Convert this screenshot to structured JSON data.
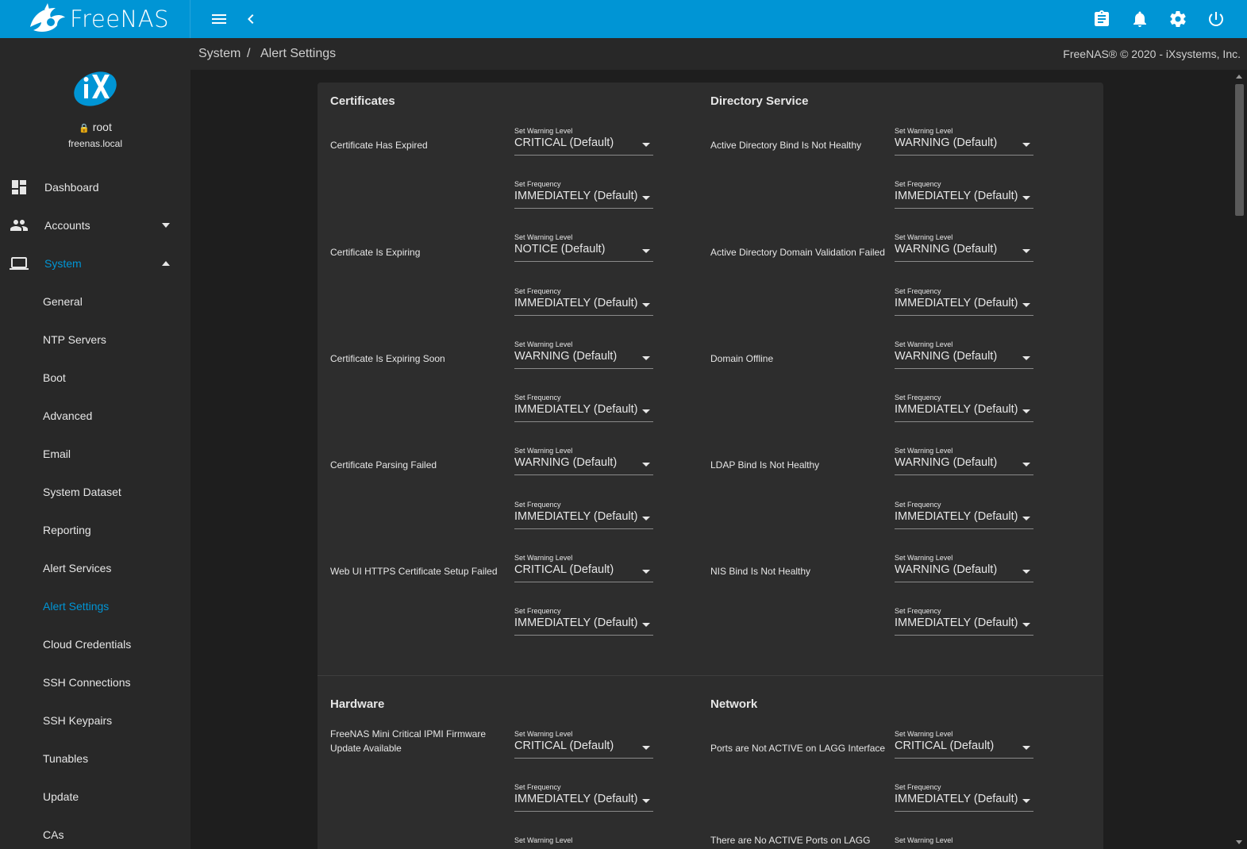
{
  "app": {
    "brand": "FreeNAS",
    "colors": {
      "accent": "#0095d5",
      "sidebar_bg": "#282828",
      "card_bg": "#2d2d2d",
      "page_bg": "#1e1e1e"
    }
  },
  "topbar": {
    "icons": [
      "menu-icon",
      "back-chevron-icon",
      "clipboard-icon",
      "bell-icon",
      "gear-icon",
      "power-icon"
    ]
  },
  "profile": {
    "user": "root",
    "host": "freenas.local"
  },
  "nav": {
    "dashboard": "Dashboard",
    "accounts": "Accounts",
    "system": "System",
    "system_items": [
      "General",
      "NTP Servers",
      "Boot",
      "Advanced",
      "Email",
      "System Dataset",
      "Reporting",
      "Alert Services",
      "Alert Settings",
      "Cloud Credentials",
      "SSH Connections",
      "SSH Keypairs",
      "Tunables",
      "Update",
      "CAs"
    ],
    "active_item": "Alert Settings"
  },
  "breadcrumb": {
    "parent": "System",
    "sep": "/",
    "current": "Alert Settings"
  },
  "copyright": "FreeNAS® © 2020 - iXsystems, Inc.",
  "labels": {
    "level": "Set Warning Level",
    "frequency": "Set Frequency"
  },
  "sections": {
    "certificates": {
      "title": "Certificates",
      "alerts": [
        {
          "name": "Certificate Has Expired",
          "level": "CRITICAL (Default)",
          "frequency": "IMMEDIATELY (Default)"
        },
        {
          "name": "Certificate Is Expiring",
          "level": "NOTICE (Default)",
          "frequency": "IMMEDIATELY (Default)"
        },
        {
          "name": "Certificate Is Expiring Soon",
          "level": "WARNING (Default)",
          "frequency": "IMMEDIATELY (Default)"
        },
        {
          "name": "Certificate Parsing Failed",
          "level": "WARNING (Default)",
          "frequency": "IMMEDIATELY (Default)"
        },
        {
          "name": "Web UI HTTPS Certificate Setup Failed",
          "level": "CRITICAL (Default)",
          "frequency": "IMMEDIATELY (Default)"
        }
      ]
    },
    "directory_service": {
      "title": "Directory Service",
      "alerts": [
        {
          "name": "Active Directory Bind Is Not Healthy",
          "level": "WARNING (Default)",
          "frequency": "IMMEDIATELY (Default)"
        },
        {
          "name": "Active Directory Domain Validation Failed",
          "level": "WARNING (Default)",
          "frequency": "IMMEDIATELY (Default)"
        },
        {
          "name": "Domain Offline",
          "level": "WARNING (Default)",
          "frequency": "IMMEDIATELY (Default)"
        },
        {
          "name": "LDAP Bind Is Not Healthy",
          "level": "WARNING (Default)",
          "frequency": "IMMEDIATELY (Default)"
        },
        {
          "name": "NIS Bind Is Not Healthy",
          "level": "WARNING (Default)",
          "frequency": "IMMEDIATELY (Default)"
        }
      ]
    },
    "hardware": {
      "title": "Hardware",
      "alerts": [
        {
          "name": "FreeNAS Mini Critical IPMI Firmware Update Available",
          "level": "CRITICAL (Default)",
          "frequency": "IMMEDIATELY (Default)"
        }
      ]
    },
    "network": {
      "title": "Network",
      "alerts": [
        {
          "name": "Ports are Not ACTIVE on LAGG Interface",
          "level": "CRITICAL (Default)",
          "frequency": "IMMEDIATELY (Default)"
        },
        {
          "name": "There are No ACTIVE Ports on LAGG",
          "level": "",
          "frequency": ""
        }
      ]
    }
  }
}
